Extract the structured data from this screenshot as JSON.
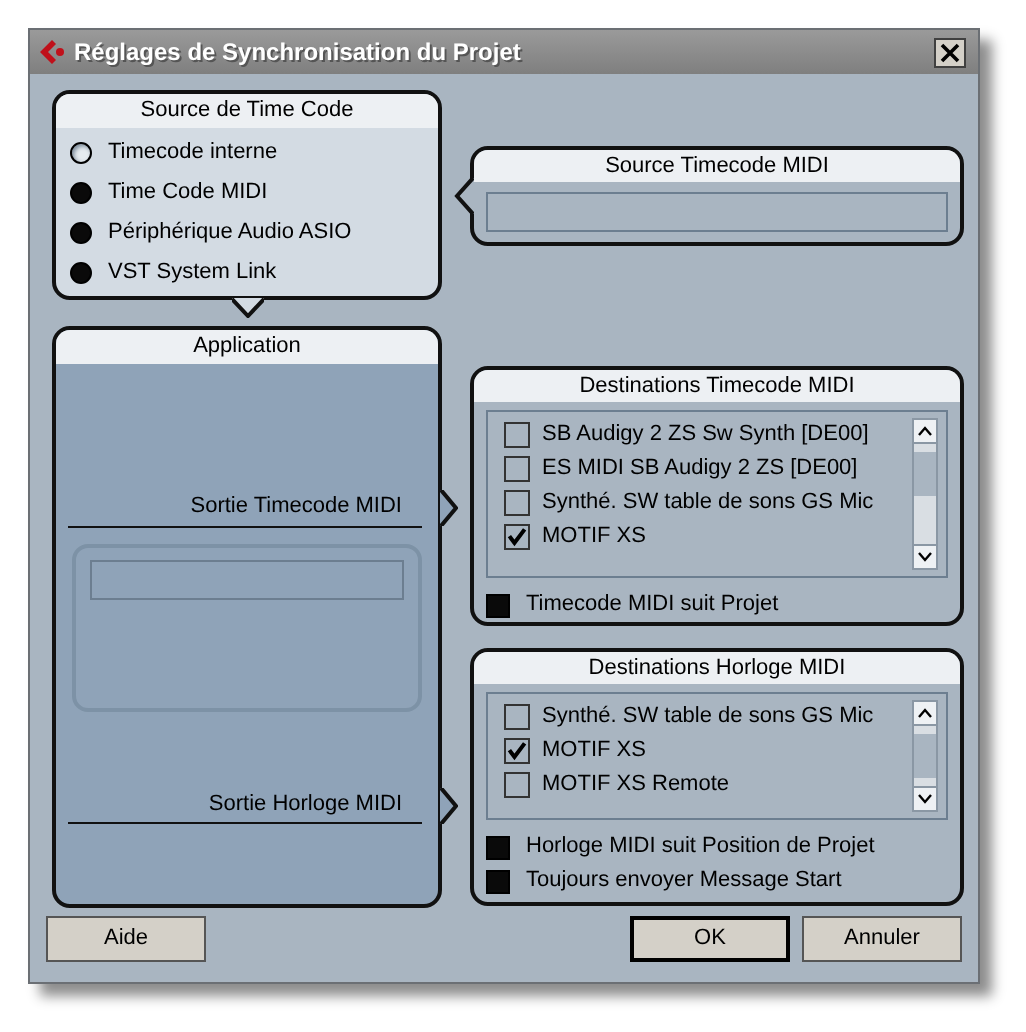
{
  "window": {
    "title": "Réglages de Synchronisation du Projet"
  },
  "timecode_source": {
    "title": "Source de Time Code",
    "options": [
      {
        "label": "Timecode interne",
        "selected": true
      },
      {
        "label": "Time Code MIDI",
        "selected": false
      },
      {
        "label": "Périphérique Audio ASIO",
        "selected": false
      },
      {
        "label": "VST System Link",
        "selected": false
      }
    ]
  },
  "midi_timecode_source": {
    "title": "Source Timecode MIDI"
  },
  "application": {
    "title": "Application",
    "outputs": [
      "Sortie Timecode MIDI",
      "Sortie Horloge MIDI"
    ]
  },
  "midi_timecode_destinations": {
    "title": "Destinations Timecode MIDI",
    "items": [
      {
        "label": "SB Audigy 2 ZS Sw Synth [DE00]",
        "checked": false
      },
      {
        "label": "ES MIDI SB Audigy 2 ZS [DE00]",
        "checked": false
      },
      {
        "label": "Synthé. SW table de sons GS Mic",
        "checked": false
      },
      {
        "label": "MOTIF XS",
        "checked": true
      }
    ],
    "options": [
      {
        "label": "Timecode MIDI suit Projet",
        "checked": false
      }
    ]
  },
  "midi_clock_destinations": {
    "title": "Destinations Horloge MIDI",
    "items": [
      {
        "label": "Synthé. SW table de sons GS Mic",
        "checked": false
      },
      {
        "label": "MOTIF XS",
        "checked": true
      },
      {
        "label": "MOTIF XS Remote",
        "checked": false
      }
    ],
    "options": [
      {
        "label": "Horloge MIDI suit Position de Projet",
        "checked": false
      },
      {
        "label": "Toujours envoyer Message Start",
        "checked": false
      }
    ]
  },
  "buttons": [
    {
      "label": "Aide",
      "kind": "help"
    },
    {
      "label": "OK",
      "kind": "default"
    },
    {
      "label": "Annuler",
      "kind": "cancel"
    }
  ]
}
